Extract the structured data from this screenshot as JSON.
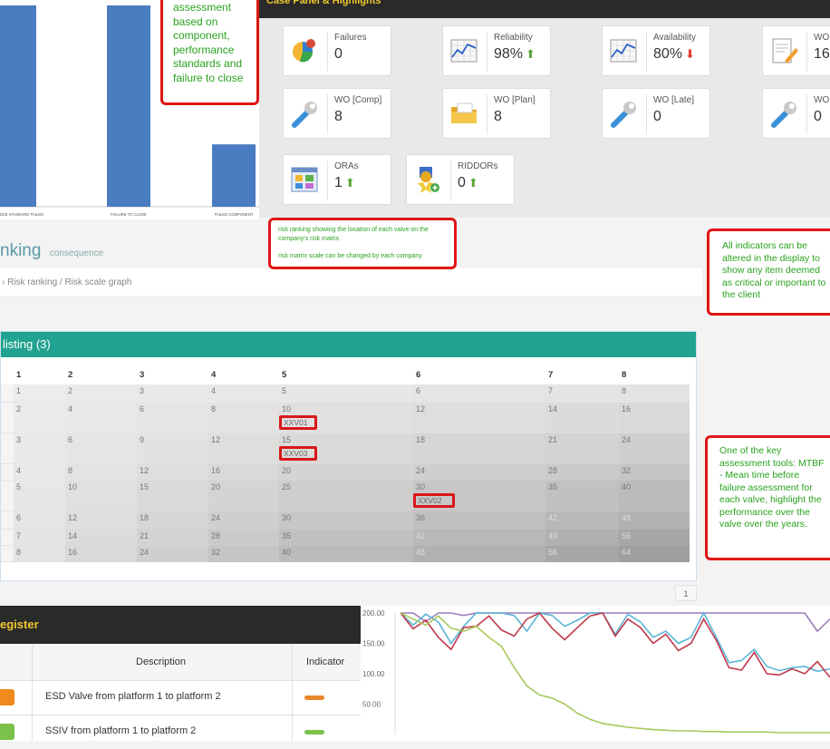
{
  "bar_chart": {
    "categories": [
      "PERFORMANCE STANDARD FAILED",
      "FAILURE TO CLOSE",
      "FAILED COMPONENT"
    ],
    "color": "#4a7cc1",
    "bars": [
      {
        "category": "PERFORMANCE STANDARD FAILED",
        "value": 100
      },
      {
        "category": "FAILURE TO CLOSE",
        "value": 100
      },
      {
        "category": "FAILED COMPONENT",
        "value": 31
      }
    ]
  },
  "callouts": {
    "assessment": "assessment based on component, performance standards and failure to close",
    "matrix_line1": "risk ranking showing the location of each valve on the company's risk matrix.",
    "matrix_line2": "risk matrix scale can be changed by each company",
    "indicators": "All indicators can be altered in the display to show any item deemed as critical or important to the client",
    "mtbf": "One of the key assessment tools: MTBF - Mean time before failure assessment for each valve, highlight the performance over the valve over the years."
  },
  "kpi": {
    "header": "Case Panel & Highlights",
    "cards": [
      {
        "label": "Failures",
        "value": "0",
        "arrow": "",
        "icon": "pie-chart-icon"
      },
      {
        "label": "Reliability",
        "value": "98%",
        "arrow": "up",
        "icon": "line-graph-icon"
      },
      {
        "label": "Availability",
        "value": "80%",
        "arrow": "down",
        "icon": "line-graph-icon"
      },
      {
        "label": "WO [",
        "value": "16",
        "arrow": "",
        "icon": "document-edit-icon"
      },
      {
        "label": "WO [Comp]",
        "value": "8",
        "arrow": "",
        "icon": "wrench-icon"
      },
      {
        "label": "WO [Plan]",
        "value": "8",
        "arrow": "",
        "icon": "folder-icon"
      },
      {
        "label": "WO [Late]",
        "value": "0",
        "arrow": "",
        "icon": "wrench-icon"
      },
      {
        "label": "WO [",
        "value": "0",
        "arrow": "",
        "icon": "wrench-icon"
      },
      {
        "label": "ORAs",
        "value": "1",
        "arrow": "up",
        "icon": "dashboard-icon"
      },
      {
        "label": "RIDDORs",
        "value": "0",
        "arrow": "up",
        "icon": "award-star-icon"
      }
    ]
  },
  "risk": {
    "title": "nking",
    "subtitle": "consequence",
    "breadcrumb": "› Risk ranking / Risk scale graph",
    "listing_title": "listing (3)",
    "columns": [
      "1",
      "2",
      "3",
      "4",
      "5",
      "6",
      "7",
      "8"
    ],
    "rows": [
      [
        "1",
        "2",
        "3",
        "4",
        "5",
        "6",
        "7",
        "8"
      ],
      [
        "2",
        "4",
        "6",
        "8",
        "10",
        "12",
        "14",
        "16"
      ],
      [
        "3",
        "6",
        "9",
        "12",
        "15",
        "18",
        "21",
        "24"
      ],
      [
        "4",
        "8",
        "12",
        "16",
        "20",
        "24",
        "28",
        "32"
      ],
      [
        "5",
        "10",
        "15",
        "20",
        "25",
        "30",
        "35",
        "40"
      ],
      [
        "6",
        "12",
        "18",
        "24",
        "30",
        "36",
        "42",
        "48"
      ],
      [
        "7",
        "14",
        "21",
        "28",
        "35",
        "42",
        "49",
        "56"
      ],
      [
        "8",
        "16",
        "24",
        "32",
        "40",
        "48",
        "56",
        "64"
      ]
    ],
    "valves": [
      {
        "tag": "XXV01",
        "row": 1,
        "col": 4
      },
      {
        "tag": "XXV03",
        "row": 2,
        "col": 4
      },
      {
        "tag": "XXV02",
        "row": 4,
        "col": 5
      }
    ],
    "pager": "1"
  },
  "register": {
    "title": "egister",
    "col_description": "Description",
    "col_indicator": "Indicator",
    "rows": [
      {
        "description": "ESD Valve from platform 1 to platform 2",
        "badge_color": "#f08a1c",
        "indicator_color": "#e8862a"
      },
      {
        "description": "SSIV from platform 1 to platform 2",
        "badge_color": "#7cc24a",
        "indicator_color": "#7cc24a"
      }
    ]
  },
  "chart_data": {
    "type": "line",
    "title": "",
    "xlabel": "",
    "ylabel": "",
    "ylim": [
      0,
      200
    ],
    "yticks": [
      "200.00",
      "150.00",
      "100.00",
      "50.00"
    ],
    "x": [
      0,
      1,
      2,
      3,
      4,
      5,
      6,
      7,
      8,
      9,
      10,
      11,
      12,
      13,
      14,
      15,
      16,
      17,
      18,
      19,
      20,
      21,
      22,
      23,
      24,
      25,
      26,
      27,
      28,
      29,
      30,
      31,
      32,
      33,
      34
    ],
    "series": [
      {
        "color": "#9a7fb8",
        "values": [
          200,
          200,
          186,
          200,
          200,
          196,
          200,
          200,
          200,
          200,
          200,
          200,
          200,
          200,
          200,
          200,
          200,
          200,
          200,
          200,
          200,
          200,
          200,
          200,
          200,
          200,
          200,
          200,
          200,
          200,
          200,
          200,
          200,
          170,
          190
        ]
      },
      {
        "color": "#5ab4d6",
        "values": [
          200,
          180,
          198,
          185,
          150,
          178,
          200,
          200,
          200,
          196,
          170,
          200,
          196,
          178,
          188,
          200,
          200,
          165,
          198,
          185,
          160,
          170,
          150,
          160,
          200,
          160,
          118,
          122,
          140,
          112,
          105,
          110,
          112,
          104,
          108
        ]
      },
      {
        "color": "#c0394b",
        "values": [
          200,
          174,
          188,
          160,
          140,
          176,
          178,
          195,
          172,
          162,
          190,
          200,
          175,
          156,
          176,
          195,
          200,
          162,
          190,
          176,
          150,
          165,
          138,
          150,
          190,
          155,
          110,
          106,
          135,
          100,
          98,
          108,
          100,
          120,
          94
        ]
      },
      {
        "color": "#a7c85a",
        "values": [
          200,
          190,
          180,
          195,
          175,
          170,
          178,
          160,
          145,
          110,
          80,
          65,
          60,
          50,
          35,
          25,
          18,
          15,
          12,
          10,
          8,
          7,
          6,
          6,
          5,
          5,
          4,
          4,
          4,
          4,
          3,
          3,
          3,
          3,
          3
        ]
      }
    ]
  }
}
